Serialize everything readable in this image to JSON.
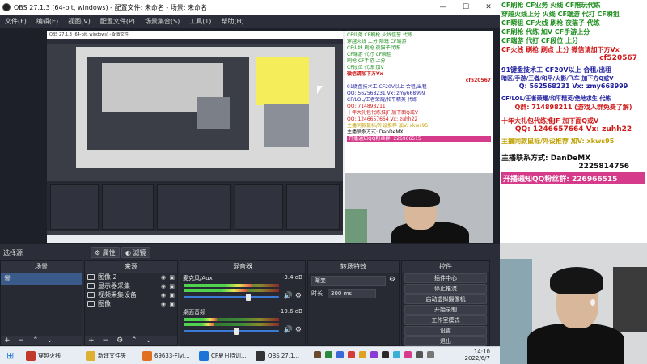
{
  "window": {
    "title": "OBS 27.1.3 (64-bit, windows) - 配置文件: 未命名 - 场景: 未命名",
    "controls": {
      "min": "—",
      "max": "☐",
      "close": "✕"
    }
  },
  "menu": [
    "文件(F)",
    "编辑(E)",
    "视图(V)",
    "配置文件(P)",
    "场景集合(S)",
    "工具(T)",
    "帮助(H)"
  ],
  "toolbar": {
    "scene_filter_label": "选择源",
    "properties_label": "属性",
    "filters_label": "滤镜"
  },
  "docks": {
    "scenes": {
      "title": "场景",
      "items": [
        "景"
      ]
    },
    "sources": {
      "title": "来源",
      "items": [
        "图像 2",
        "显示器采集",
        "视频采集设备",
        "图像"
      ]
    },
    "mixer": {
      "title": "混音器",
      "channels": [
        {
          "name": "麦克风/Aux",
          "db": "-3.4 dB",
          "level": 0.72,
          "volume": 0.68
        },
        {
          "name": "桌面音频",
          "db": "-19.6 dB",
          "level": 0.35,
          "volume": 0.55
        }
      ]
    },
    "transitions": {
      "title": "转场特效",
      "type": "渐变",
      "duration_label": "时长",
      "duration_value": "300 ms"
    },
    "controls": {
      "title": "控件",
      "buttons": [
        "插件中心",
        "停止推流",
        "启动虚拟摄像机",
        "开始录制",
        "工作室模式",
        "设置",
        "退出"
      ]
    }
  },
  "canvas_promo": {
    "lines": [
      {
        "text": "CF业务 CF刷枪 火线信誉 代练",
        "color": "#1f8f1f"
      },
      {
        "text": "穿越火线 上分 陪玩 CF端游",
        "color": "#1f8f1f"
      },
      {
        "text": "CF火线 刷枪 夜猫子代练",
        "color": "#1f8f1f"
      },
      {
        "text": "CF端游 代打 CF瞬狙",
        "color": "#1f8f1f"
      },
      {
        "text": "刷枪 CF手游 上分",
        "color": "#1f8f1f"
      },
      {
        "text": "CF段位 代练 加V",
        "color": "#1f8f1f"
      },
      {
        "text": "微信请加下方Vx",
        "color": "#d01818"
      },
      {
        "text": "cf520567",
        "color": "#d01818"
      },
      {
        "text": "91键盘技术工 CF20V以上 合租/出租",
        "color": "#1f1f9f"
      },
      {
        "text": "QQ: 562568231 Vx: zmy668999",
        "color": "#1f1f9f"
      },
      {
        "text": "CF/LOL/王者荣耀/和平精英 代练",
        "color": "#1f1f9f"
      },
      {
        "text": "QQ: 714898211",
        "color": "#d01818"
      },
      {
        "text": "十年大礼包代练推JF 加下面Q或V",
        "color": "#d01818"
      },
      {
        "text": "QQ: 1246657664 Vx: zuhh22",
        "color": "#d01818"
      },
      {
        "text": "主播同款鼠标/外设推荐 加V: xkws95",
        "color": "#c0a000"
      },
      {
        "text": "主播联系方式:   DanDeMX",
        "color": "#111111"
      },
      {
        "text": "开播通知QQ粉丝群: 226966515",
        "color": "#ffffff"
      }
    ]
  },
  "right_promo": {
    "lines": [
      {
        "text": "CF刷枪 CF业务 火线 CF陪玩代练",
        "color": "#1f8f1f",
        "size": 8
      },
      {
        "text": "穿越火线上分 火线 CF端游 代打 CF瞬狙",
        "color": "#1f8f1f",
        "size": 8
      },
      {
        "text": "CF瞬狙 CF火线 刷枪 夜猫子 代练",
        "color": "#1f8f1f",
        "size": 8
      },
      {
        "text": "CF刷枪 代练 加V CF手游上分",
        "color": "#1f8f1f",
        "size": 8
      },
      {
        "text": "CF端游 代打 CF段位 上分",
        "color": "#1f8f1f",
        "size": 8
      },
      {
        "text": "CF火线 刷枪 刷点 上分 微信请加下方Vx",
        "color": "#d01818",
        "size": 8
      },
      {
        "text": "cf520567",
        "color": "#d01818",
        "size": 9
      },
      {
        "text": "91键盘技术工 CF20V以上  合租/出租",
        "color": "#1f1f9f",
        "size": 8
      },
      {
        "text": "暗区/手游/王者/和平/火影/飞车 加下方Q或V",
        "color": "#1f1f9f",
        "size": 7
      },
      {
        "text": "Q: 562568231  Vx: zmy668999",
        "color": "#1f1f9f",
        "size": 8
      },
      {
        "text": "CF/LOL/王者荣耀/和平精英/绝地求生 代练",
        "color": "#1f1f9f",
        "size": 7
      },
      {
        "text": "Q群: 714898211 (游戏入群免费了解)",
        "color": "#d01818",
        "size": 8
      },
      {
        "text": "十年大礼包代练推JF 加下面Q或V",
        "color": "#d01818",
        "size": 8
      },
      {
        "text": "QQ: 1246657664  Vx: zuhh22",
        "color": "#d01818",
        "size": 9
      },
      {
        "text": "主播同款鼠标/外设推荐 加V: xkws95",
        "color": "#c0a000",
        "size": 8
      },
      {
        "text": "主播联系方式:    DanDeMX",
        "color": "#111111",
        "size": 9
      },
      {
        "text": "2225814756",
        "color": "#111111",
        "size": 9
      },
      {
        "text": "开播通知QQ粉丝群: 226966515",
        "color": "#ffffff",
        "size": 9
      }
    ]
  },
  "taskbar": {
    "items": [
      {
        "label": "穿越火线",
        "color": "#c0392b"
      },
      {
        "label": "新建文件夹",
        "color": "#e0b030"
      },
      {
        "label": "69633-Flyi...",
        "color": "#e07020"
      },
      {
        "label": "CF夏日特训...",
        "color": "#1e73d6"
      },
      {
        "label": "OBS 27.1...",
        "color": "#333333"
      }
    ],
    "time": "14:10",
    "date": "2022/6/7"
  },
  "nested_title": "OBS 27.1.3 (64-bit, windows) - 配置文件"
}
